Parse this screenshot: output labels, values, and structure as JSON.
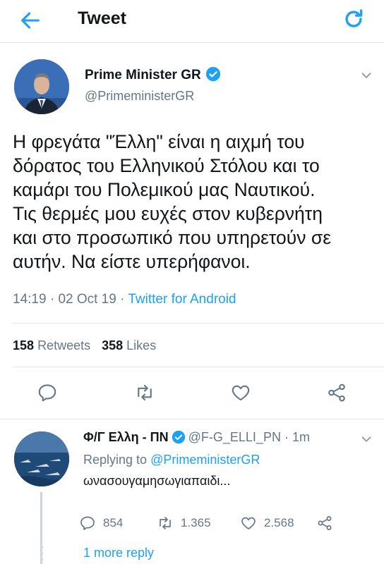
{
  "header": {
    "title": "Tweet",
    "back_icon": "back-arrow-icon",
    "refresh_icon": "refresh-icon"
  },
  "tweet": {
    "author_name": "Prime Minister GR",
    "author_handle": "@PrimeministerGR",
    "verified": true,
    "text": "Η φρεγάτα \"Έλλη\" είναι η αιχμή του\nδόρατος του Ελληνικού Στόλου και το\nκαμάρι του Πολεμικού μας Ναυτικού.\nΤις θερμές μου ευχές στον κυβερνήτη\nκαι στο προσωπικό που υπηρετούν σε\nαυτήν. Να είστε υπερήφανοι.",
    "time": "14:19",
    "date": "02 Oct 19",
    "separator": "·",
    "source": "Twitter for Android",
    "retweets_count": "158",
    "retweets_label": "Retweets",
    "likes_count": "358",
    "likes_label": "Likes"
  },
  "reply": {
    "author_name": "Φ/Γ Ελλη - ΠΝ",
    "author_handle": "@F-G_ELLI_PN",
    "time_ago": "· 1m",
    "replying_prefix": "Replying to",
    "replying_to": "@PrimeministerGR",
    "text": "ωνασουγαμησωγιαπαιδι...",
    "replies_count": "854",
    "retweets_count": "1.365",
    "likes_count": "2.568",
    "more_replies": "1 more reply"
  },
  "colors": {
    "accent": "#1da1f2",
    "secondary_text": "#657786",
    "primary_text": "#14171a",
    "divider": "#e1e8ed"
  }
}
